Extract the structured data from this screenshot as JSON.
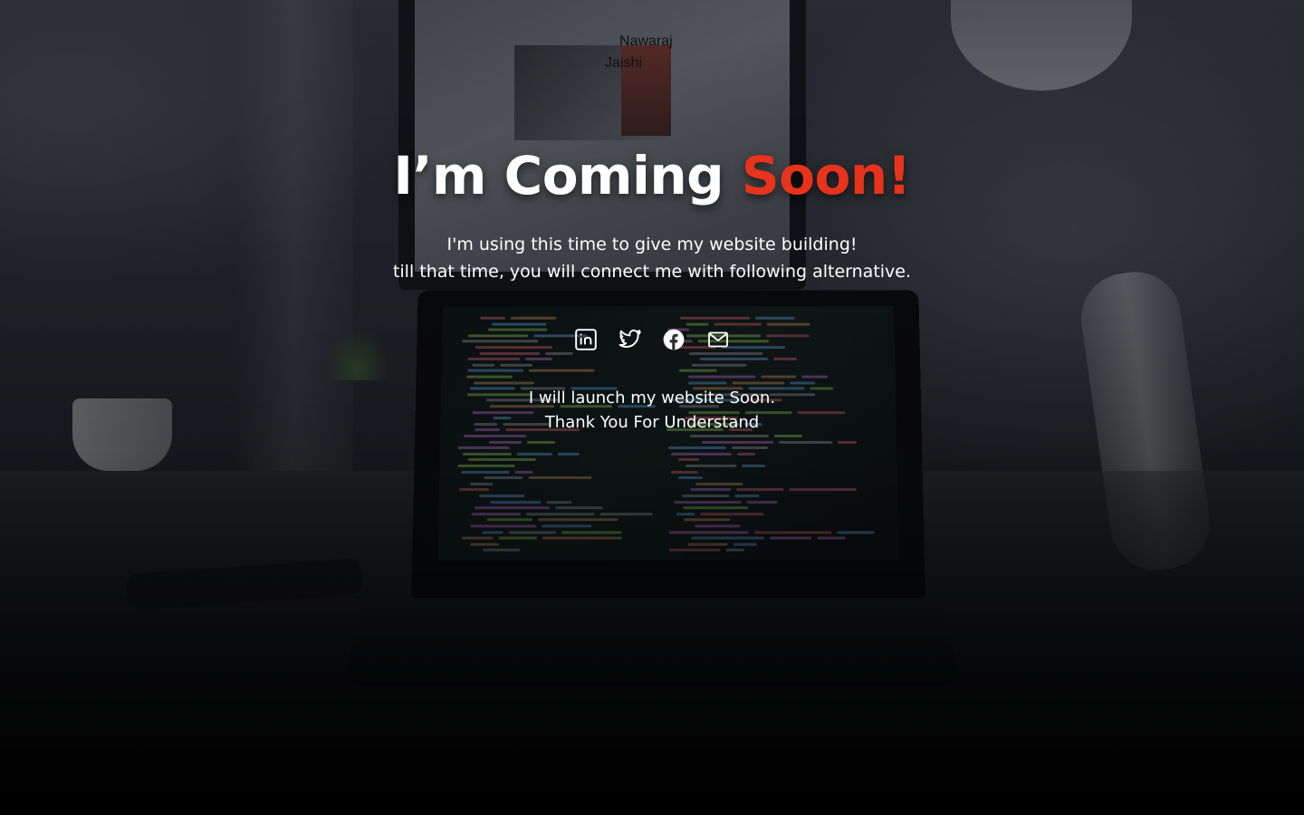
{
  "logo": {
    "alt_line1": "Nawaraj",
    "alt_line2": "Jaishi"
  },
  "headline": {
    "main": "I’m Coming ",
    "accent": "Soon!"
  },
  "subtitle": {
    "line1": "I'm using this time to give my website building!",
    "line2": "till that time, you will connect me with following alternative."
  },
  "socials": [
    {
      "icon": "linkedin-icon"
    },
    {
      "icon": "twitter-icon"
    },
    {
      "icon": "facebook-icon"
    },
    {
      "icon": "mail-icon"
    }
  ],
  "footer": {
    "line1": "I will launch my website Soon.",
    "line2": "Thank You For Understand"
  },
  "colors": {
    "accent": "#e8331c",
    "text": "#ffffff"
  }
}
